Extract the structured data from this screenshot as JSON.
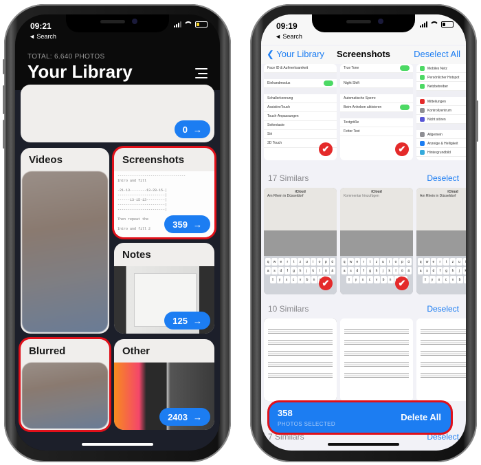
{
  "left_phone": {
    "status": {
      "time": "09:21",
      "back_label": "◄ Search"
    },
    "header": {
      "total_label": "TOTAL: 6.640 PHOTOS",
      "title": "Your Library",
      "menu_icon": "hamburger-menu-icon"
    },
    "cards": [
      {
        "id": "top",
        "title": "",
        "count": "0",
        "selected": false
      },
      {
        "id": "videos",
        "title": "Videos",
        "count": "",
        "selected": false
      },
      {
        "id": "screenshots",
        "title": "Screenshots",
        "count": "359",
        "selected": true
      },
      {
        "id": "notes",
        "title": "Notes",
        "count": "125",
        "selected": false
      },
      {
        "id": "blurred",
        "title": "Blurred",
        "count": "",
        "selected": true
      },
      {
        "id": "other",
        "title": "Other",
        "count": "2403",
        "selected": false
      }
    ],
    "arrow": "→",
    "screenshot_preview_text": "---------------------------------\nIntro and fill\n\n-21-13--------13-28-15-|\n-----------------------|\n------13-15-13---------|\n-----------------------|\n-----------------------|\n\nThen repeat the\n\nIntro and fill 2"
  },
  "right_phone": {
    "status": {
      "time": "09:19",
      "back_label": "◄ Search"
    },
    "navbar": {
      "back_label": "Your Library",
      "title": "Screenshots",
      "right_action": "Deselect All"
    },
    "settings_tiles": [
      {
        "rows": [
          "Face ID & Aufmerksamkeit",
          "",
          "Einhandmodus",
          "",
          "Schallerkennung",
          "AssistiveTouch",
          "Touch-Anpassungen",
          "Seitentaste",
          "Siri",
          "3D Touch"
        ],
        "checked": true
      },
      {
        "rows": [
          "True Tone",
          "",
          "Night Shift",
          "",
          "Automatische Sperre",
          "Beim Anheben aktivieren",
          "",
          "Textgröße",
          "Fetter Text"
        ],
        "checked": true
      },
      {
        "rows": [
          "Mobiles Netz",
          "Persönlicher Hotspot",
          "Netzbetreiber",
          "",
          "Mitteilungen",
          "Kontrollzentrum",
          "Nicht stören",
          "",
          "Allgemein",
          "Anzeige & Helligkeit",
          "Hintergrundbild"
        ],
        "checked": false
      }
    ],
    "groups": [
      {
        "count_label": "17 Similars",
        "action": "Deselect",
        "tile_texts": [
          "Am Rhein in Düsseldorf",
          "Kommentar hinzufügen",
          "Am Rhein in Düsseldorf"
        ],
        "tile_header": "iCloud",
        "checked": [
          true,
          true,
          false
        ]
      },
      {
        "count_label": "10 Similars",
        "action": "Deselect"
      },
      {
        "count_label": "7 Similars",
        "action": "Deselect"
      }
    ],
    "keyboard_rows": [
      [
        "q",
        "w",
        "e",
        "r",
        "t",
        "z",
        "u",
        "i",
        "o",
        "p",
        "ü"
      ],
      [
        "a",
        "s",
        "d",
        "f",
        "g",
        "h",
        "j",
        "k",
        "l",
        "ö",
        "ä"
      ],
      [
        "⇧",
        "y",
        "x",
        "c",
        "v",
        "b",
        "n",
        "m",
        "⌫"
      ]
    ],
    "selection_bar": {
      "count": "358",
      "label": "PHOTOS SELECTED",
      "action": "Delete All"
    }
  },
  "colors": {
    "accent": "#1c7df2",
    "highlight": "#e0101a",
    "check": "#e42a2a",
    "toggle": "#4cd964"
  }
}
